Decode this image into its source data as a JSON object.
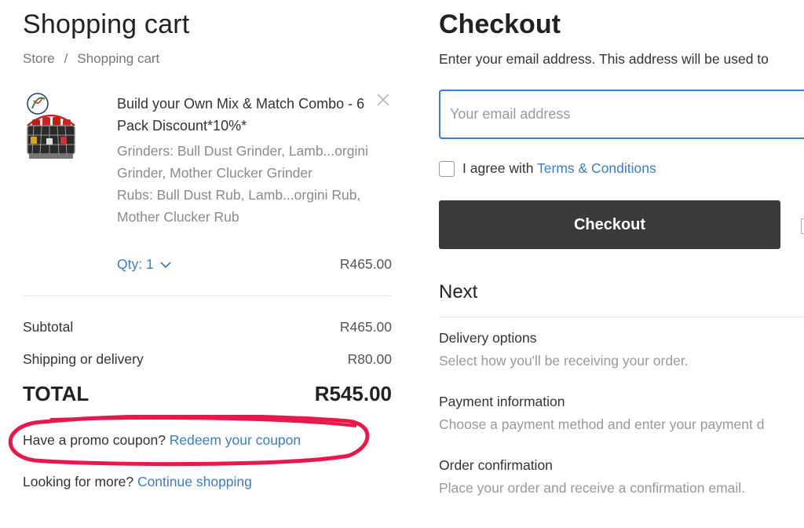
{
  "cart": {
    "title": "Shopping cart",
    "breadcrumb": [
      "Store",
      "/",
      "Shopping cart"
    ],
    "item": {
      "name": "Build your Own Mix & Match Combo - 6 Pack Discount*10%*",
      "options": [
        "Grinders: Bull Dust Grinder, Lamb...orgini Grinder, Mother Clucker Grinder",
        "Rubs: Bull Dust Rub, Lamb...orgini Rub, Mother Clucker Rub"
      ],
      "qty_label": "Qty: 1",
      "price": "R465.00"
    },
    "subtotal": {
      "label": "Subtotal",
      "value": "R465.00"
    },
    "shipping": {
      "label": "Shipping or delivery",
      "value": "R80.00"
    },
    "total": {
      "label": "TOTAL",
      "value": "R545.00"
    },
    "promo": {
      "text": "Have a promo coupon?",
      "link": "Redeem your coupon"
    },
    "more": {
      "text": "Looking for more?",
      "link": "Continue shopping"
    }
  },
  "checkout": {
    "title": "Checkout",
    "description": "Enter your email address. This address will be used to",
    "email_placeholder": "Your email address",
    "agree_text": "I agree with",
    "terms_link": "Terms & Conditions",
    "button_label": "Checkout",
    "next_title": "Next",
    "steps": [
      {
        "title": "Delivery options",
        "desc": "Select how you'll be receiving your order."
      },
      {
        "title": "Payment information",
        "desc": "Choose a payment method and enter your payment d"
      },
      {
        "title": "Order confirmation",
        "desc": "Place your order and receive a confirmation email."
      }
    ]
  },
  "colors": {
    "accent": "#3e7cc0",
    "button": "#3a3a3a",
    "annotation": "#e8194a"
  }
}
